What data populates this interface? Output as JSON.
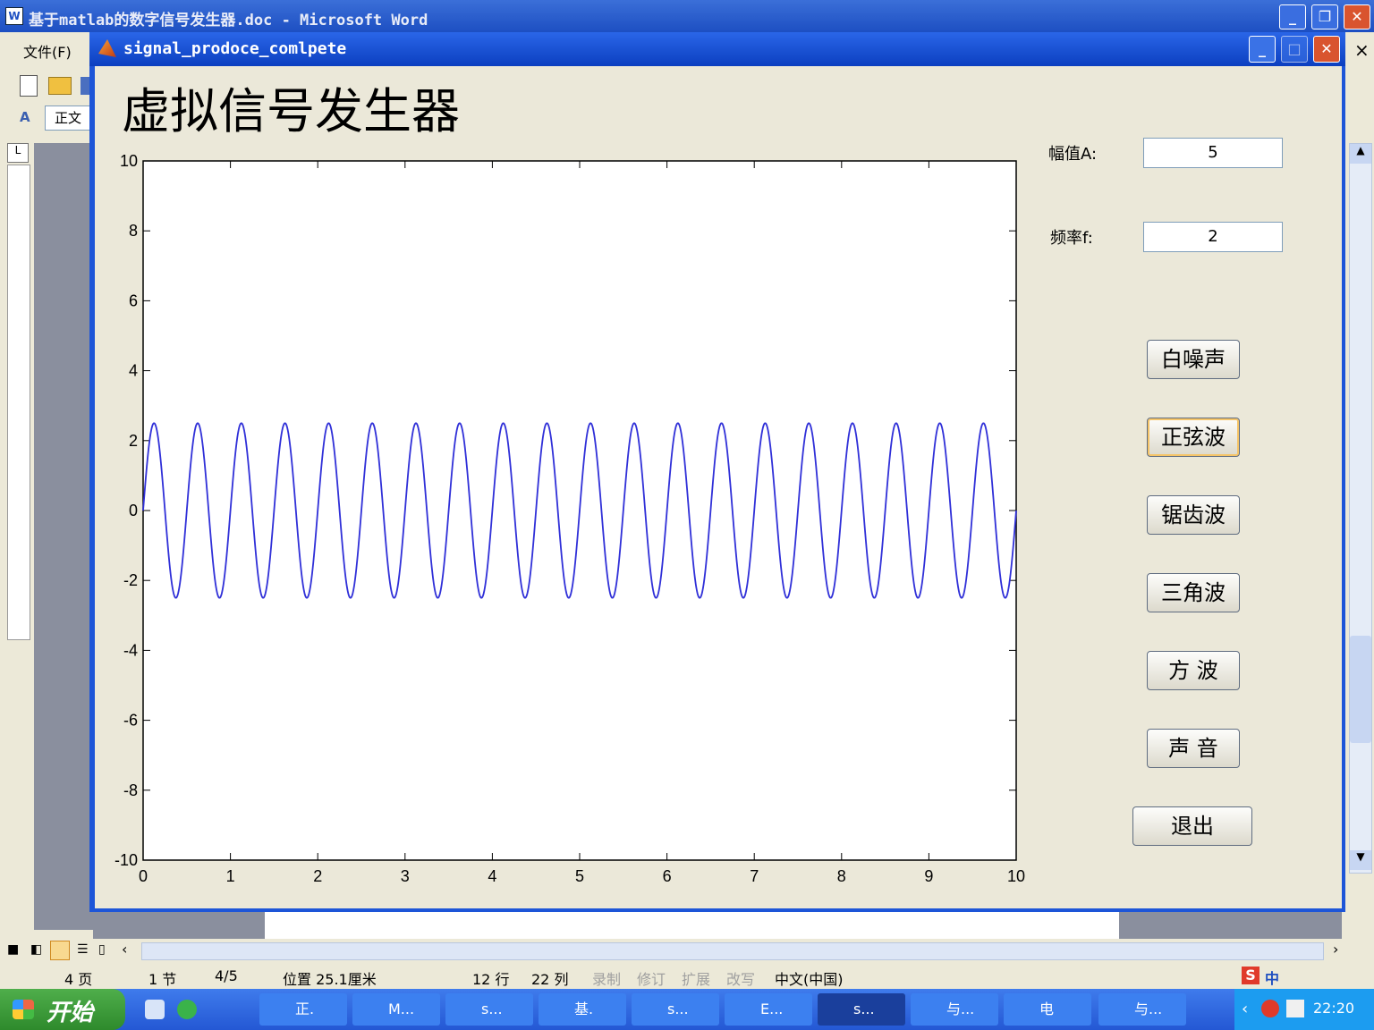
{
  "word": {
    "title": "基于matlab的数字信号发生器.doc - Microsoft Word",
    "menu_file": "文件(F)",
    "style_box": "正文",
    "close_doc": "×",
    "status": {
      "page": "4 页",
      "section": "1 节",
      "pages": "4/5",
      "position": "位置 25.1厘米",
      "line": "12 行",
      "column": "22 列",
      "rec": "录制",
      "trk": "修订",
      "ext": "扩展",
      "ovr": "改写",
      "lang": "中文(中国)"
    }
  },
  "taskbar": {
    "start": "开始",
    "items": [
      "正.",
      "M...",
      "s...",
      "基.",
      "s...",
      "E...",
      "s...",
      "与...",
      "电",
      "与..."
    ],
    "clock": "22:20"
  },
  "figure": {
    "title": "signal_prodoce_comlpete",
    "gui_title": "虚拟信号发生器",
    "amplitude_label": "幅值A:",
    "amplitude_value": "5",
    "frequency_label": "频率f:",
    "frequency_value": "2",
    "buttons": {
      "white_noise": "白噪声",
      "sine": "正弦波",
      "sawtooth": "锯齿波",
      "triangle": "三角波",
      "square": "方  波",
      "sound": "声  音",
      "exit": "退出"
    }
  },
  "chart_data": {
    "type": "line",
    "title": "",
    "xlabel": "",
    "ylabel": "",
    "xlim": [
      0,
      10
    ],
    "ylim": [
      -10,
      10
    ],
    "x_ticks": [
      "0",
      "1",
      "2",
      "3",
      "4",
      "5",
      "6",
      "7",
      "8",
      "9",
      "10"
    ],
    "y_ticks": [
      "10",
      "8",
      "6",
      "4",
      "2",
      "0",
      "-2",
      "-4",
      "-6",
      "-8",
      "-10"
    ],
    "series": [
      {
        "amplitude": 2.5,
        "frequency": 2,
        "function": "sine",
        "color": "#3030d8"
      }
    ],
    "grid": false,
    "colors": {
      "line": "#3030d8",
      "axes_bg": "#ffffff"
    }
  }
}
